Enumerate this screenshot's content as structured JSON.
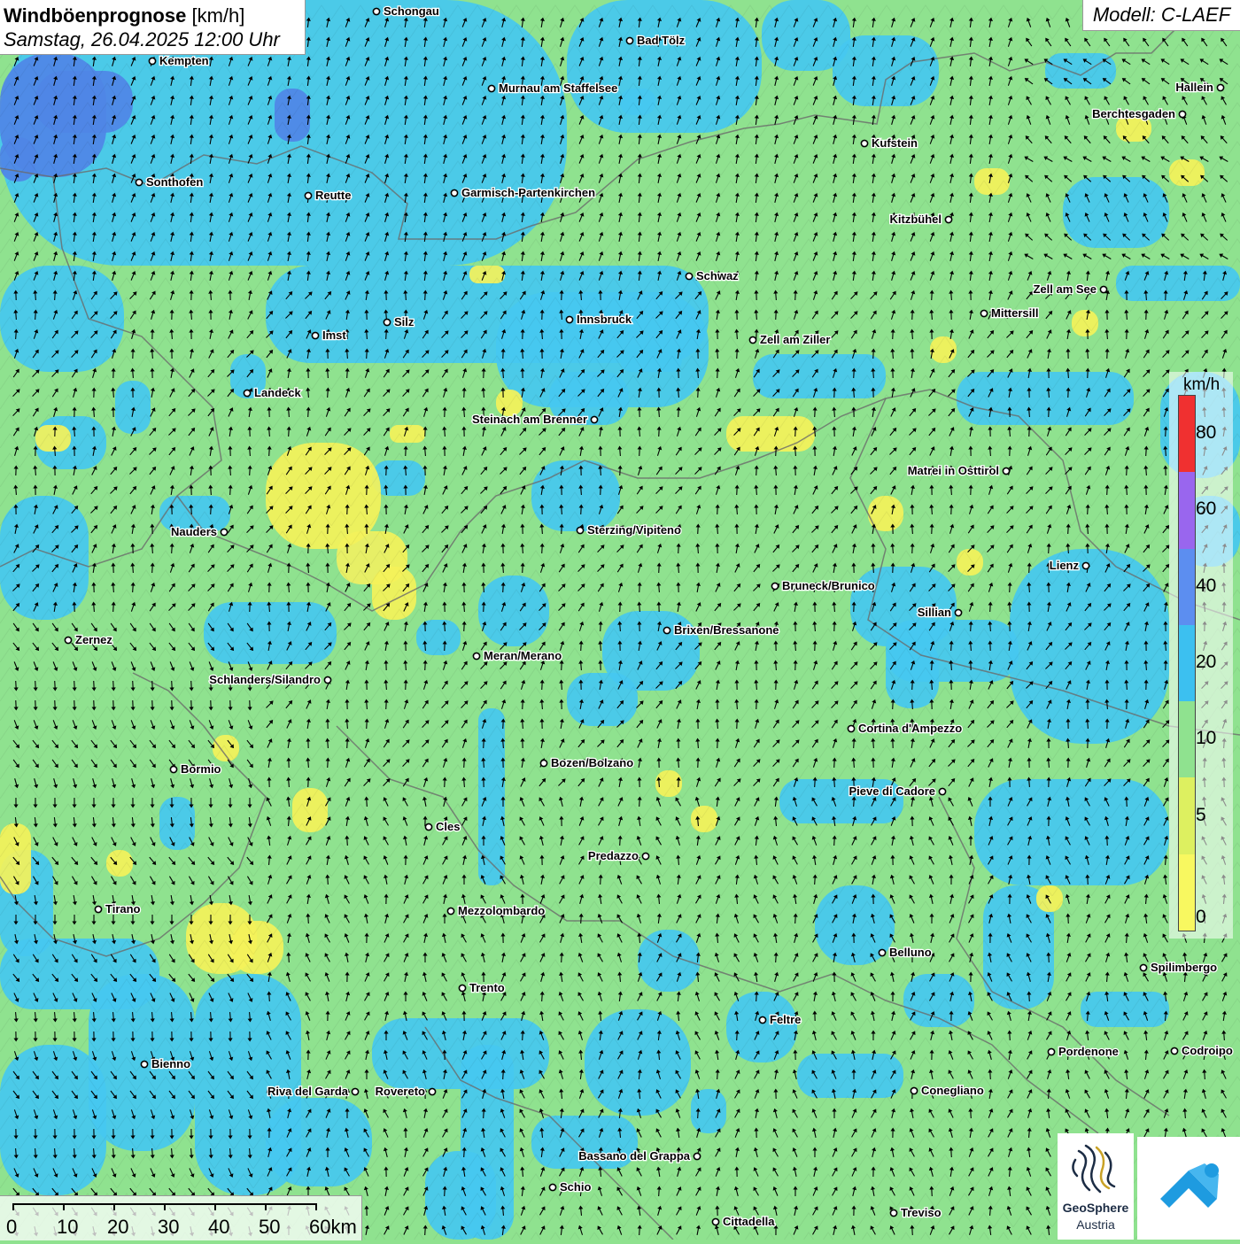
{
  "header": {
    "title": "Windböenprognose",
    "unit": "[km/h]",
    "datetime": "Samstag, 26.04.2025 12:00 Uhr",
    "model": "Modell: C-LAEF"
  },
  "legend": {
    "unit": "km/h",
    "labels": [
      "80",
      "60",
      "40",
      "20",
      "10",
      "5",
      "0"
    ],
    "colors": [
      "#f03030",
      "#9966ee",
      "#5c8ef0",
      "#3cc0f0",
      "#8fe28f",
      "#ddf060",
      "#f8f860"
    ]
  },
  "scale": {
    "labels": [
      "0",
      "10",
      "20",
      "30",
      "40",
      "50",
      "60km"
    ]
  },
  "logo": {
    "name": "GeoSphere",
    "country": "Austria"
  },
  "colors": {
    "calm": "#f4f25a",
    "light": "#8fe28f",
    "moderate": "#45c8f0",
    "stronger": "#4f86e6"
  },
  "cities": [
    {
      "name": "Schongau"
    },
    {
      "name": "Bad Tölz"
    },
    {
      "name": "Kempten"
    },
    {
      "name": "Murnau am Staffelsee"
    },
    {
      "name": "Hallein"
    },
    {
      "name": "Berchtesgaden"
    },
    {
      "name": "Kufstein"
    },
    {
      "name": "Sonthofen"
    },
    {
      "name": "Reutte"
    },
    {
      "name": "Garmisch-Partenkirchen"
    },
    {
      "name": "Kitzbühel"
    },
    {
      "name": "Schwaz"
    },
    {
      "name": "Zell am See"
    },
    {
      "name": "Mittersill"
    },
    {
      "name": "Silz"
    },
    {
      "name": "Innsbruck"
    },
    {
      "name": "Imst"
    },
    {
      "name": "Zell am Ziller"
    },
    {
      "name": "Landeck"
    },
    {
      "name": "Steinach am Brenner"
    },
    {
      "name": "Matrei in Osttirol"
    },
    {
      "name": "Nauders"
    },
    {
      "name": "Sterzing/Vipiteno"
    },
    {
      "name": "Lienz"
    },
    {
      "name": "Bruneck/Brunico"
    },
    {
      "name": "Sillian"
    },
    {
      "name": "Zernez"
    },
    {
      "name": "Brixen/Bressanone"
    },
    {
      "name": "Meran/Merano"
    },
    {
      "name": "Schlanders/Silandro"
    },
    {
      "name": "Cortina d'Ampezzo"
    },
    {
      "name": "Bozen/Bolzano"
    },
    {
      "name": "Bormio"
    },
    {
      "name": "Pieve di Cadore"
    },
    {
      "name": "Cles"
    },
    {
      "name": "Predazzo"
    },
    {
      "name": "Tirano"
    },
    {
      "name": "Mezzolombardo"
    },
    {
      "name": "Belluno"
    },
    {
      "name": "Spilimbergo"
    },
    {
      "name": "Trento"
    },
    {
      "name": "Feltre"
    },
    {
      "name": "Pordenone"
    },
    {
      "name": "Codroipo"
    },
    {
      "name": "Bienno"
    },
    {
      "name": "Riva del Garda"
    },
    {
      "name": "Rovereto"
    },
    {
      "name": "Conegliano"
    },
    {
      "name": "Bassano del Grappa"
    },
    {
      "name": "Schio"
    },
    {
      "name": "Treviso"
    },
    {
      "name": "Cittadella"
    }
  ]
}
